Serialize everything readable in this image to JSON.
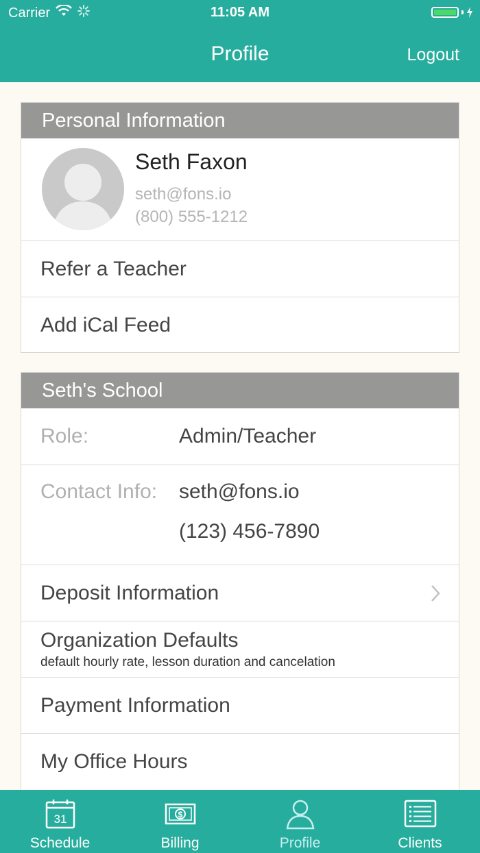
{
  "status_bar": {
    "carrier": "Carrier",
    "time": "11:05 AM"
  },
  "nav": {
    "title": "Profile",
    "logout_label": "Logout"
  },
  "personal": {
    "header": "Personal Information",
    "name": "Seth Faxon",
    "email": "seth@fons.io",
    "phone": "(800) 555-1212",
    "items": [
      {
        "label": "Refer a Teacher"
      },
      {
        "label": "Add iCal Feed"
      }
    ]
  },
  "school": {
    "header": "Seth's School",
    "role_label": "Role:",
    "role_value": "Admin/Teacher",
    "contact_label": "Contact Info:",
    "contact_email": "seth@fons.io",
    "contact_phone": "(123) 456-7890",
    "deposit_label": "Deposit Information",
    "org_defaults_label": "Organization Defaults",
    "org_defaults_sub": "default hourly rate, lesson duration and cancelation",
    "payment_label": "Payment Information",
    "office_hours_label": "My Office Hours"
  },
  "tabs": [
    {
      "label": "Schedule",
      "icon": "calendar-icon",
      "badge": "31"
    },
    {
      "label": "Billing",
      "icon": "dollar-bill-icon"
    },
    {
      "label": "Profile",
      "icon": "person-icon"
    },
    {
      "label": "Clients",
      "icon": "list-icon"
    }
  ],
  "colors": {
    "accent": "#27ad9d",
    "section_header": "#979795",
    "active_tab": "#c7eef0"
  }
}
